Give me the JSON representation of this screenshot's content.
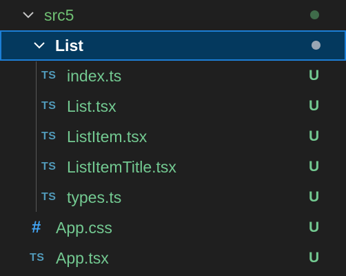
{
  "explorer": {
    "root_folder": {
      "name": "src5",
      "expanded": true,
      "status_dot_color": "#3f6b4a"
    },
    "sub_folder": {
      "name": "List",
      "expanded": true,
      "selected": true,
      "status_dot_color": "#9aa6b4"
    },
    "files": [
      {
        "name": "index.ts",
        "icon": "ts-icon",
        "icon_text": "TS",
        "status": "U"
      },
      {
        "name": "List.tsx",
        "icon": "ts-icon",
        "icon_text": "TS",
        "status": "U"
      },
      {
        "name": "ListItem.tsx",
        "icon": "ts-icon",
        "icon_text": "TS",
        "status": "U"
      },
      {
        "name": "ListItemTitle.tsx",
        "icon": "ts-icon",
        "icon_text": "TS",
        "status": "U"
      },
      {
        "name": "types.ts",
        "icon": "ts-icon",
        "icon_text": "TS",
        "status": "U"
      },
      {
        "name": "App.css",
        "icon": "css-icon",
        "icon_text": "#",
        "status": "U"
      },
      {
        "name": "App.tsx",
        "icon": "ts-icon",
        "icon_text": "TS",
        "status": "U"
      }
    ],
    "colors": {
      "background": "#1f1f1f",
      "selection_background": "#04395e",
      "selection_border": "#1c7ed6",
      "untracked_green": "#73c991",
      "ts_icon_blue": "#519aba",
      "css_icon_blue": "#42a5f5"
    }
  }
}
